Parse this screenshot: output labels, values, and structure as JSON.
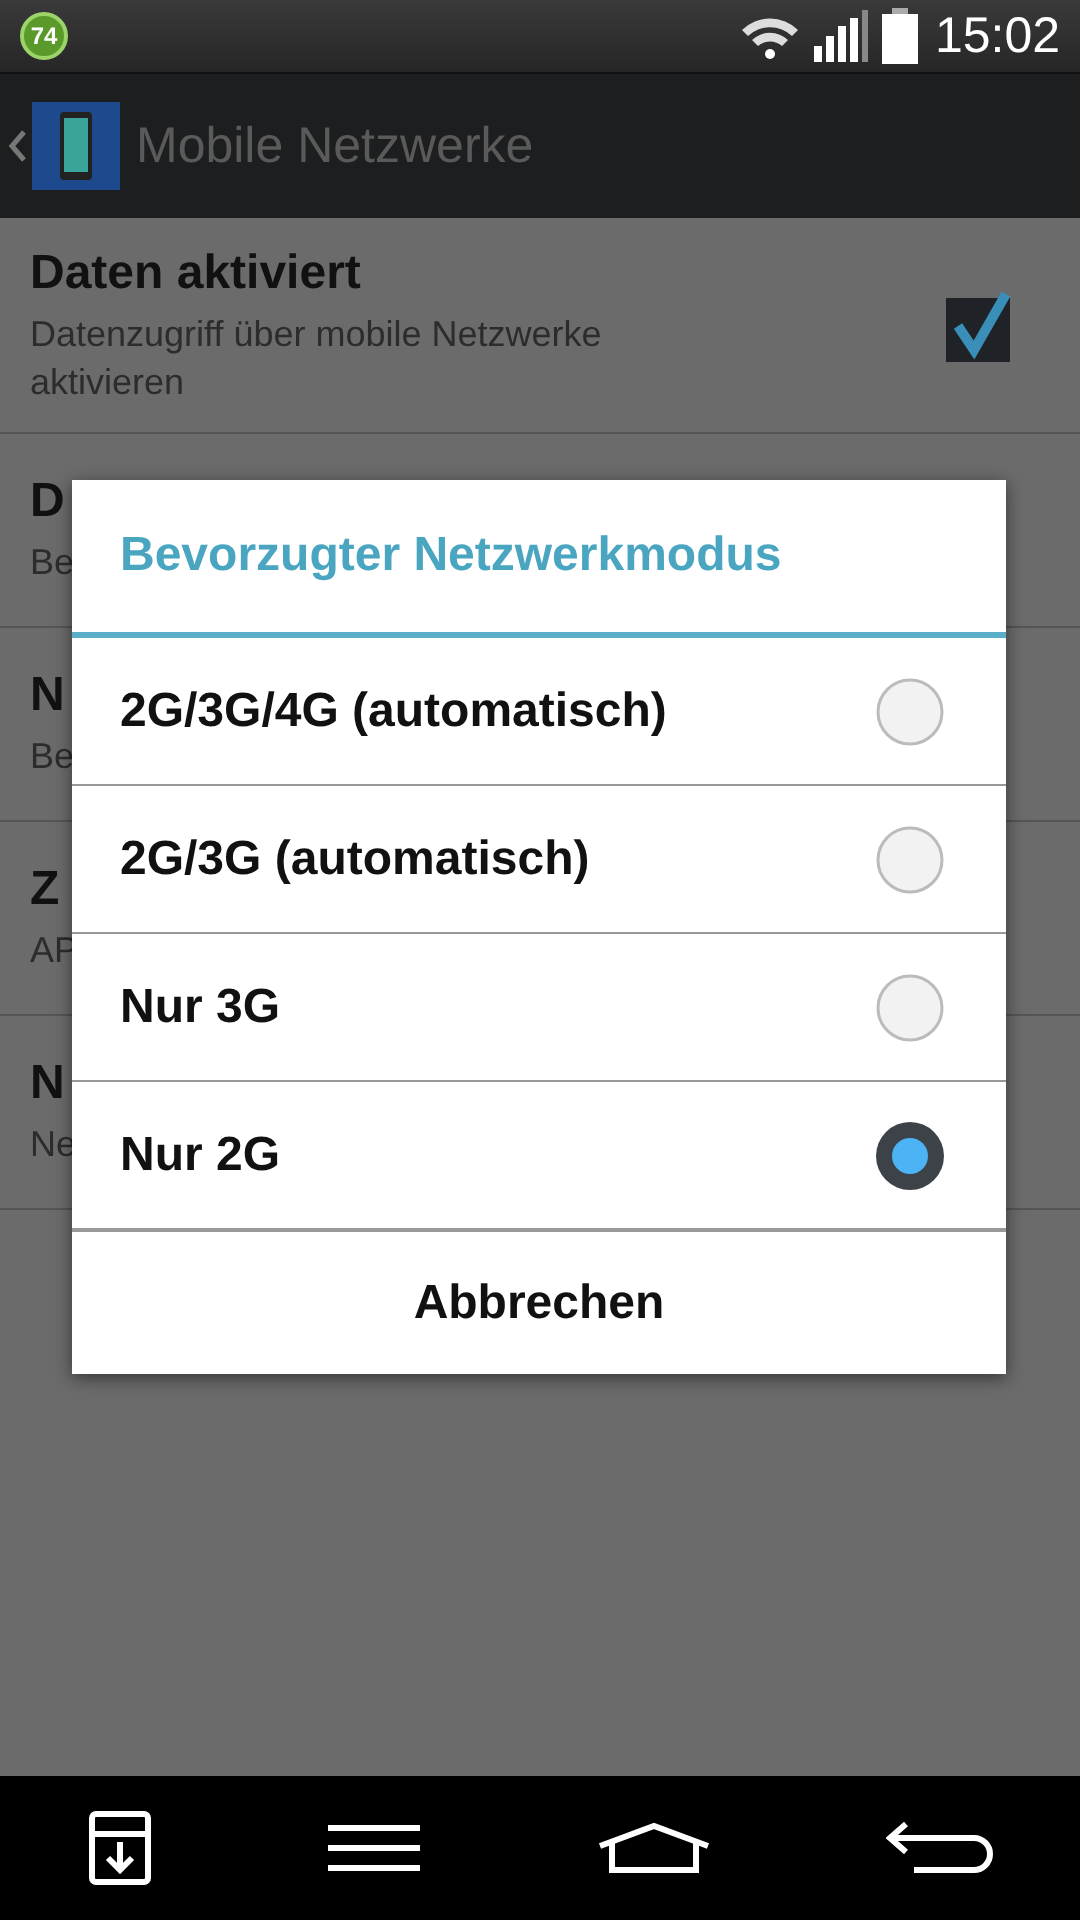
{
  "status_bar": {
    "badge": "74",
    "time": "15:02"
  },
  "action_bar": {
    "title": "Mobile Netzwerke"
  },
  "settings": [
    {
      "title": "Daten aktiviert",
      "subtitle": "Datenzugriff über mobile Netzwerke aktivieren",
      "checked": true
    },
    {
      "title": "D",
      "subtitle": "Be"
    },
    {
      "title": "N",
      "subtitle": "Be"
    },
    {
      "title": "Z",
      "subtitle": "AP"
    },
    {
      "title": "N",
      "subtitle": "Ne"
    }
  ],
  "dialog": {
    "title": "Bevorzugter Netzwerkmodus",
    "options": [
      {
        "label": "2G/3G/4G (automatisch)",
        "selected": false
      },
      {
        "label": "2G/3G (automatisch)",
        "selected": false
      },
      {
        "label": "Nur 3G",
        "selected": false
      },
      {
        "label": "Nur 2G",
        "selected": true
      }
    ],
    "cancel": "Abbrechen"
  }
}
